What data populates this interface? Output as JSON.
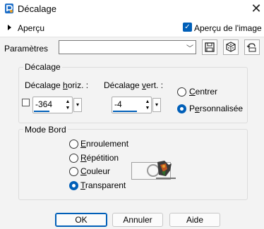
{
  "window": {
    "title": "Décalage"
  },
  "preview": {
    "toggle_label": "Aperçu",
    "image_preview_label": "Aperçu de l'image",
    "image_preview_checked": true
  },
  "params": {
    "label": "Paramètres",
    "preset_value": ""
  },
  "offset_group": {
    "title": "Décalage",
    "horiz_label_pre": "Décalage ",
    "horiz_label_u": "h",
    "horiz_label_post": "oriz. :",
    "horiz_value": "-364",
    "vert_label_pre": "Décalage ",
    "vert_label_u": "v",
    "vert_label_post": "ert. :",
    "vert_value": "-4",
    "radio_center_u": "C",
    "radio_center_rest": "entrer",
    "radio_custom_pre": "P",
    "radio_custom_u": "e",
    "radio_custom_rest": "rsonnalisée",
    "selected": "custom"
  },
  "edge_group": {
    "title": "Mode Bord",
    "opt_wrap_u": "E",
    "opt_wrap_rest": "nroulement",
    "opt_repeat_u": "R",
    "opt_repeat_rest": "épétition",
    "opt_color_u": "C",
    "opt_color_rest": "ouleur",
    "opt_transparent_u": "T",
    "opt_transparent_rest": "ransparent",
    "selected": "transparent"
  },
  "buttons": {
    "ok": "OK",
    "cancel": "Annuler",
    "help": "Aide"
  }
}
